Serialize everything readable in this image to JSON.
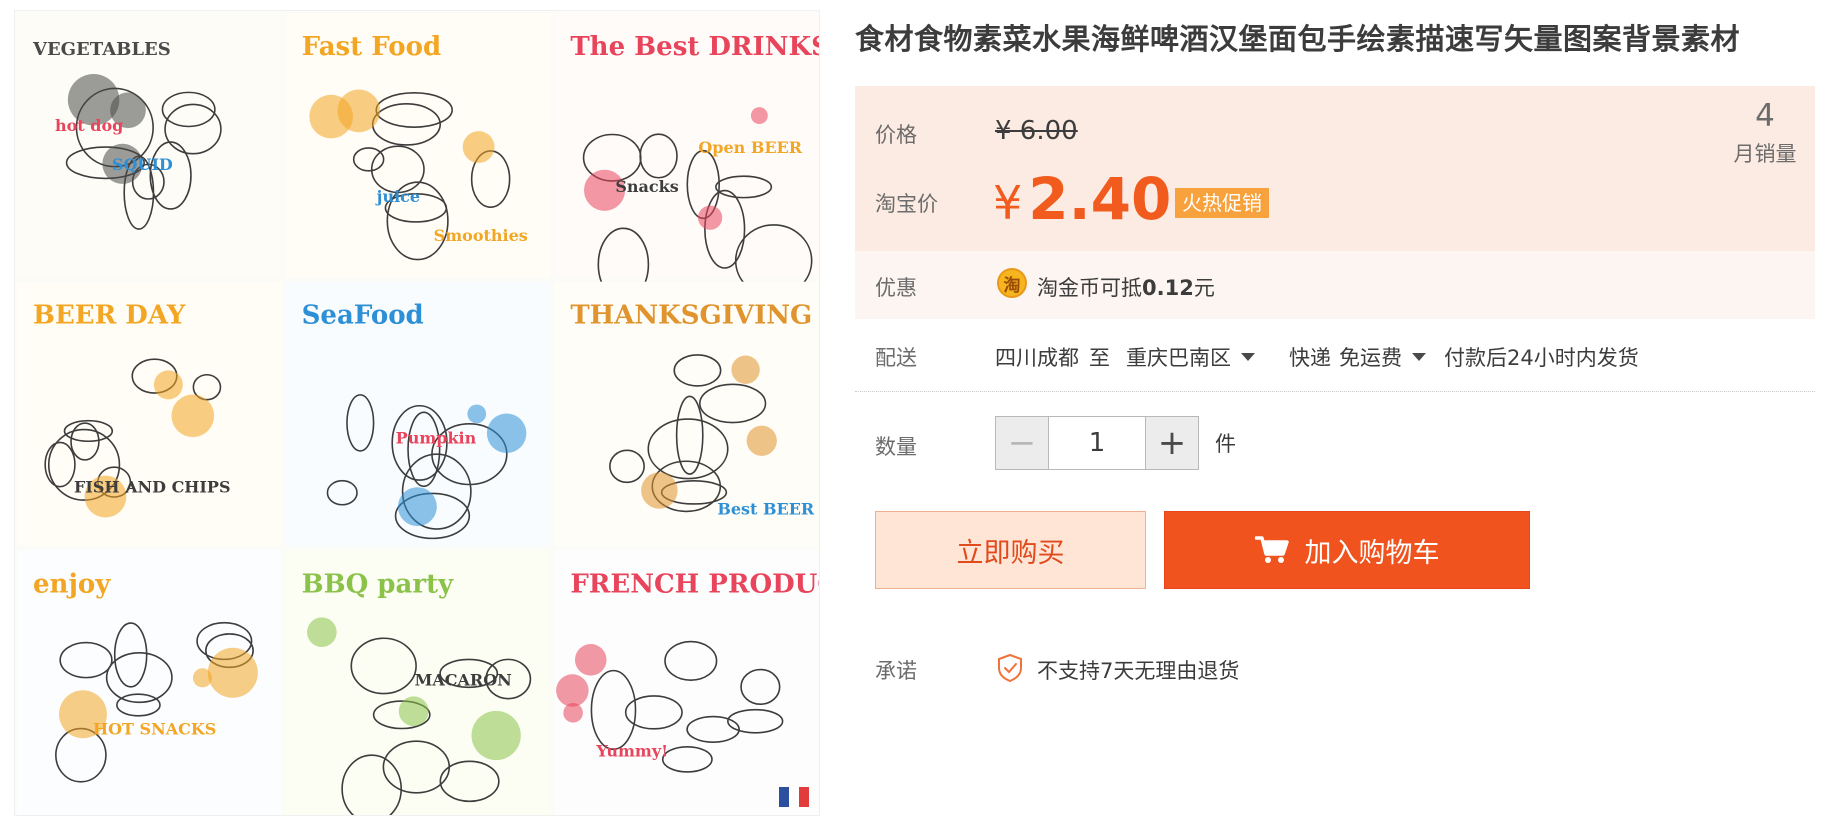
{
  "product": {
    "title": "食材食物素菜水果海鲜啤酒汉堡面包手绘素描速写矢量图案背景素材"
  },
  "image_art": {
    "panels": [
      {
        "title": "VEGETABLES",
        "bg": "#fdfcf7",
        "accent": "#4a4a4a"
      },
      {
        "title": "Fast Food",
        "bg": "#fffdf6",
        "accent": "#f2a623"
      },
      {
        "title": "The Best DRINKS",
        "bg": "#fffbf9",
        "accent": "#e8455c"
      },
      {
        "title": "BEER DAY",
        "bg": "#fffdf5",
        "accent": "#f2a623"
      },
      {
        "title": "SeaFood",
        "bg": "#f8fcff",
        "accent": "#2d8fd5"
      },
      {
        "title": "THANKSGIVING DAY",
        "bg": "#fffdf7",
        "accent": "#e0942e"
      },
      {
        "title": "enjoy",
        "bg": "#fbfdff",
        "accent": "#f2a623"
      },
      {
        "title": "BBQ party",
        "bg": "#fcfef4",
        "accent": "#8bc34a"
      },
      {
        "title": "FRENCH PRODUCTS",
        "bg": "#fdfdfd",
        "accent": "#e8455c"
      }
    ],
    "sublabels": [
      "hot dog",
      "juice",
      "Open BEER",
      "FISH AND CHIPS",
      "Pumpkin",
      "Best BEER",
      "HOT SNACKS",
      "MACARON",
      "Yummy!",
      "SQUID",
      "Smoothies",
      "Snacks"
    ]
  },
  "price": {
    "label": "价格",
    "original": "¥ 6.00",
    "taobao_label": "淘宝价",
    "currency": "¥",
    "current": "2.40",
    "badge": "火热促销"
  },
  "sales": {
    "count": "4",
    "label": "月销量"
  },
  "promotion": {
    "label": "优惠",
    "icon_glyph": "淘",
    "text_prefix": "淘金币可抵",
    "amount": "0.12",
    "text_suffix": "元"
  },
  "delivery": {
    "label": "配送",
    "from": "四川成都",
    "to_word": "至",
    "destination": "重庆巴南区",
    "method": "快递",
    "fee": "免运费",
    "dispatch": "付款后24小时内发货"
  },
  "quantity": {
    "label": "数量",
    "minus": "−",
    "value": "1",
    "plus": "+",
    "unit": "件"
  },
  "actions": {
    "buy_now": "立即购买",
    "add_to_cart": "加入购物车"
  },
  "promise": {
    "label": "承诺",
    "text": "不支持7天无理由退货"
  },
  "colors": {
    "accent": "#f25b1e",
    "price_bg": "#fcebe2",
    "badge": "#f7a23c",
    "cart_button": "#f0531e"
  }
}
